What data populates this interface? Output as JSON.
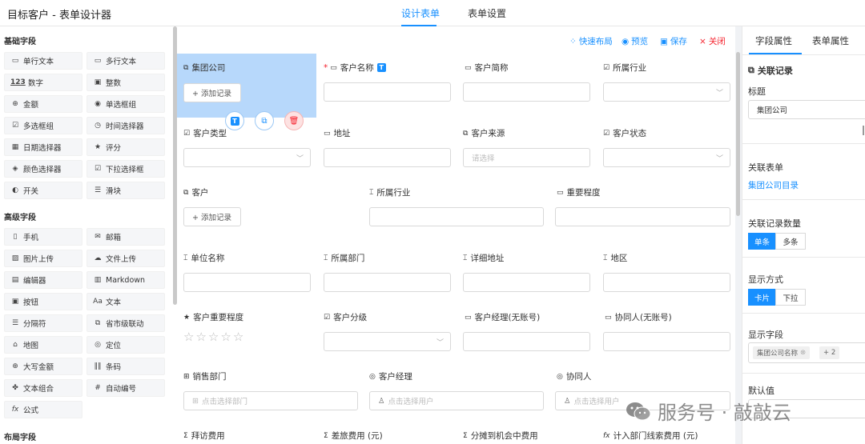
{
  "app": {
    "title": "目标客户 - 表单设计器"
  },
  "top_tabs": [
    {
      "label": "设计表单"
    },
    {
      "label": "表单设置"
    }
  ],
  "left_panel": {
    "groups": [
      {
        "title": "基础字段",
        "items": [
          {
            "label": "单行文本",
            "icon": "single-line-text-icon",
            "glyph": "▭"
          },
          {
            "label": "多行文本",
            "icon": "multi-line-text-icon",
            "glyph": "▭"
          },
          {
            "label": "数字",
            "icon": "number-icon",
            "glyph": "123"
          },
          {
            "label": "整数",
            "icon": "integer-icon",
            "glyph": "▣"
          },
          {
            "label": "金额",
            "icon": "amount-icon",
            "glyph": "⊕"
          },
          {
            "label": "单选框组",
            "icon": "radio-group-icon",
            "glyph": "◉"
          },
          {
            "label": "多选框组",
            "icon": "checkbox-group-icon",
            "glyph": "☑"
          },
          {
            "label": "时间选择器",
            "icon": "time-picker-icon",
            "glyph": "◷"
          },
          {
            "label": "日期选择器",
            "icon": "date-picker-icon",
            "glyph": "▦"
          },
          {
            "label": "评分",
            "icon": "rating-icon",
            "glyph": "★"
          },
          {
            "label": "颜色选择器",
            "icon": "color-picker-icon",
            "glyph": "◈"
          },
          {
            "label": "下拉选择框",
            "icon": "dropdown-icon",
            "glyph": "☑"
          },
          {
            "label": "开关",
            "icon": "switch-icon",
            "glyph": "◐"
          },
          {
            "label": "滑块",
            "icon": "slider-icon",
            "glyph": "☰"
          }
        ]
      },
      {
        "title": "高级字段",
        "items": [
          {
            "label": "手机",
            "icon": "mobile-icon",
            "glyph": "▯"
          },
          {
            "label": "邮箱",
            "icon": "email-icon",
            "glyph": "✉"
          },
          {
            "label": "图片上传",
            "icon": "image-upload-icon",
            "glyph": "▨"
          },
          {
            "label": "文件上传",
            "icon": "file-upload-icon",
            "glyph": "☁"
          },
          {
            "label": "编辑器",
            "icon": "editor-icon",
            "glyph": "▤"
          },
          {
            "label": "Markdown",
            "icon": "markdown-icon",
            "glyph": "▥"
          },
          {
            "label": "按钮",
            "icon": "button-icon",
            "glyph": "▣"
          },
          {
            "label": "文本",
            "icon": "text-icon",
            "glyph": "Aa"
          },
          {
            "label": "分隔符",
            "icon": "divider-icon",
            "glyph": "☰"
          },
          {
            "label": "省市级联动",
            "icon": "cascader-icon",
            "glyph": "⧉"
          },
          {
            "label": "地图",
            "icon": "map-icon",
            "glyph": "⌂"
          },
          {
            "label": "定位",
            "icon": "location-icon",
            "glyph": "◎"
          },
          {
            "label": "大写金额",
            "icon": "capital-amount-icon",
            "glyph": "⊕"
          },
          {
            "label": "条码",
            "icon": "barcode-icon",
            "glyph": "‖‖"
          },
          {
            "label": "文本组合",
            "icon": "text-combo-icon",
            "glyph": "✤"
          },
          {
            "label": "自动编号",
            "icon": "auto-number-icon",
            "glyph": "#"
          },
          {
            "label": "公式",
            "icon": "formula-icon",
            "glyph": "fx"
          }
        ]
      },
      {
        "title": "布局字段",
        "items": []
      }
    ]
  },
  "toolbar": {
    "quick_layout": "快速布局",
    "preview": "预览",
    "save": "保存",
    "close": "关闭"
  },
  "canvas": {
    "add_record": "+ 添加记录",
    "placeholder_select": "请选择",
    "placeholder_dept": "点击选择部门",
    "placeholder_user": "点击选择用户",
    "labels": {
      "group_company": "集团公司",
      "customer_name": "客户名称",
      "customer_abbr": "客户简称",
      "industry": "所属行业",
      "customer_type": "客户类型",
      "address": "地址",
      "customer_source": "客户来源",
      "customer_status": "客户状态",
      "customer": "客户",
      "industry2": "所属行业",
      "importance": "重要程度",
      "unit_name": "单位名称",
      "department": "所属部门",
      "detail_address": "详细地址",
      "region": "地区",
      "customer_importance": "客户重要程度",
      "customer_grade": "客户分级",
      "manager_no_account": "客户经理(无账号)",
      "collaborator_no_account": "协同人(无账号)",
      "sales_dept": "销售部门",
      "manager": "客户经理",
      "collaborator": "协同人",
      "visit_cost": "拜访费用",
      "travel_cost": "差旅费用 (元)",
      "allocated_cost": "分摊到机会中费用",
      "dept_lead_cost": "计入部门线索费用 (元)"
    },
    "rating": {
      "value": 0,
      "max": 5
    }
  },
  "right_panel": {
    "tabs": [
      {
        "label": "字段属性"
      },
      {
        "label": "表单属性"
      }
    ],
    "heading": "关联记录",
    "title_label": "标题",
    "title_value": "集团公司",
    "related_form_label": "关联表单",
    "related_form_value": "集团公司目录",
    "count_label": "关联记录数量",
    "count_options": [
      "单条",
      "多条"
    ],
    "display_label": "显示方式",
    "display_options": [
      "卡片",
      "下拉"
    ],
    "fields_label": "显示字段",
    "fields_tag": "集团公司名称",
    "fields_more": "+ 2",
    "default_label": "默认值"
  },
  "watermark": {
    "text": "服务号 · 敲敲云"
  },
  "colors": {
    "accent": "#1890ff",
    "danger": "#f5222d",
    "selected": "#b7d8fb"
  }
}
